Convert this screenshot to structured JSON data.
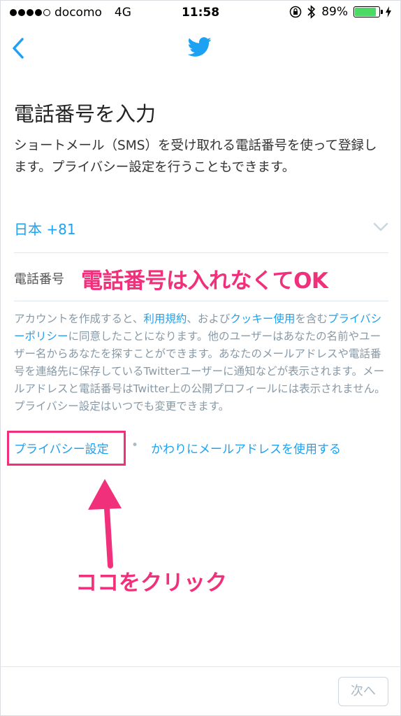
{
  "status_bar": {
    "carrier": "docomo",
    "network": "4G",
    "time": "11:58",
    "battery_percent": "89%",
    "battery_level": 0.89
  },
  "nav": {
    "back_icon": "chevron-left-icon",
    "logo_icon": "twitter-bird-icon",
    "brand_color": "#1da1f2"
  },
  "page": {
    "title": "電話番号を入力",
    "description": "ショートメール（SMS）を受け取れる電話番号を使って登録します。プライバシー設定を行うこともできます。"
  },
  "country_select": {
    "value": "日本 +81"
  },
  "phone_input": {
    "placeholder": "電話番号"
  },
  "annotations": {
    "phone_note": "電話番号は入れなくてOK",
    "click_note": "ココをクリック",
    "color": "#f0307a"
  },
  "legal": {
    "part1": "アカウントを作成すると、",
    "terms_link": "利用規約",
    "part2": "、および",
    "cookie_link": "クッキー使用",
    "part3": "を含む",
    "privacy_policy_link": "プライバシーポリシー",
    "part4": "に同意したことになります。他のユーザーはあなたの名前やユーザー名からあなたを探すことができます。あなたのメールアドレスや電話番号を連絡先に保存しているTwitterユーザーに通知などが表示されます。メールアドレスと電話番号はTwitter上の公開プロフィールには表示されません。プライバシー設定はいつでも変更できます。"
  },
  "links": {
    "privacy_settings": "プライバシー設定",
    "separator": "•",
    "use_email": "かわりにメールアドレスを使用する"
  },
  "footer": {
    "next_label": "次へ"
  }
}
